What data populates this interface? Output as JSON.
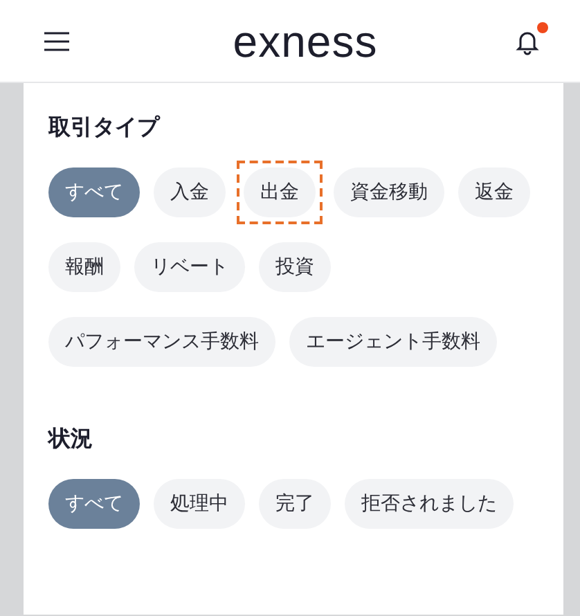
{
  "header": {
    "logo": "exness",
    "notification_dot": true
  },
  "sections": [
    {
      "title": "取引タイプ",
      "chips": [
        {
          "label": "すべて",
          "selected": true,
          "highlighted": false
        },
        {
          "label": "入金",
          "selected": false,
          "highlighted": false
        },
        {
          "label": "出金",
          "selected": false,
          "highlighted": true
        },
        {
          "label": "資金移動",
          "selected": false,
          "highlighted": false
        },
        {
          "label": "返金",
          "selected": false,
          "highlighted": false
        },
        {
          "label": "報酬",
          "selected": false,
          "highlighted": false
        },
        {
          "label": "リベート",
          "selected": false,
          "highlighted": false
        },
        {
          "label": "投資",
          "selected": false,
          "highlighted": false
        },
        {
          "label": "パフォーマンス手数料",
          "selected": false,
          "highlighted": false
        },
        {
          "label": "エージェント手数料",
          "selected": false,
          "highlighted": false
        }
      ]
    },
    {
      "title": "状況",
      "chips": [
        {
          "label": "すべて",
          "selected": true,
          "highlighted": false
        },
        {
          "label": "処理中",
          "selected": false,
          "highlighted": false
        },
        {
          "label": "完了",
          "selected": false,
          "highlighted": false
        },
        {
          "label": "拒否されました",
          "selected": false,
          "highlighted": false
        }
      ]
    }
  ]
}
